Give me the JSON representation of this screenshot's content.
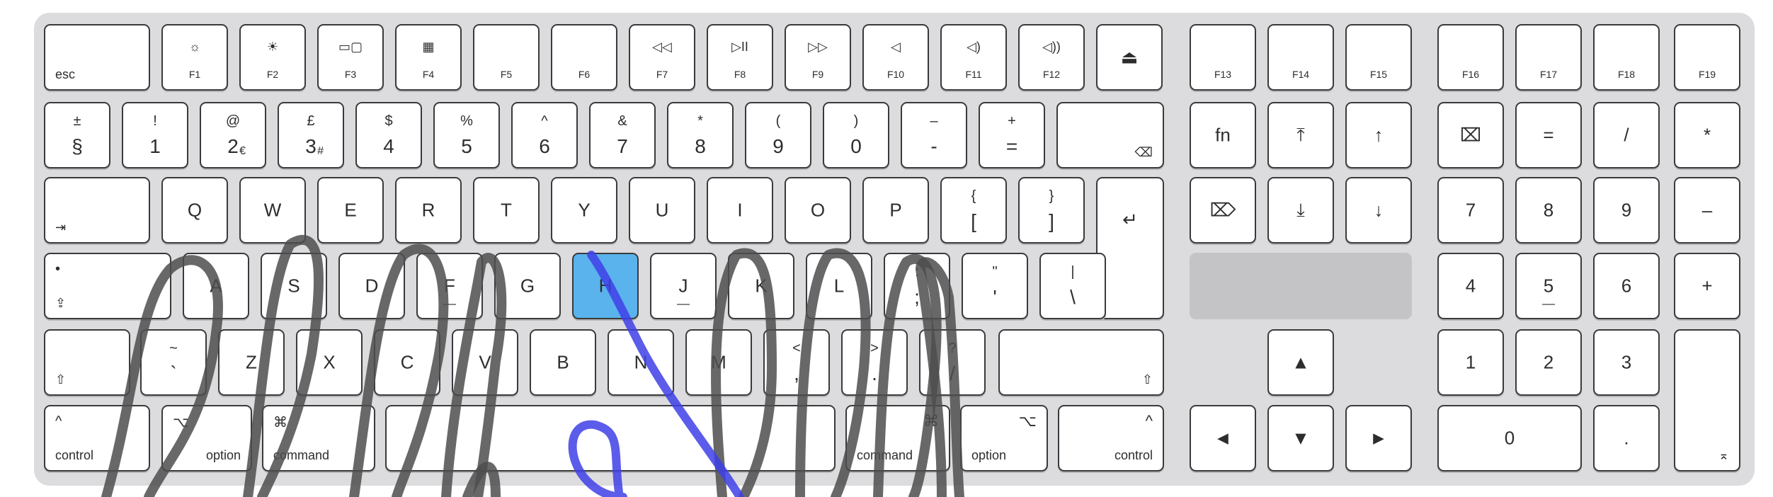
{
  "highlight_color": "#5ab3ec",
  "rows": {
    "function": [
      {
        "id": "esc",
        "label": "esc"
      },
      {
        "id": "f1",
        "icon": "brightness-down-icon",
        "label": "F1"
      },
      {
        "id": "f2",
        "icon": "brightness-up-icon",
        "label": "F2"
      },
      {
        "id": "f3",
        "icon": "mission-control-icon",
        "label": "F3"
      },
      {
        "id": "f4",
        "icon": "launchpad-icon",
        "label": "F4"
      },
      {
        "id": "f5",
        "icon": "",
        "label": "F5"
      },
      {
        "id": "f6",
        "icon": "",
        "label": "F6"
      },
      {
        "id": "f7",
        "icon": "rewind-icon",
        "label": "F7"
      },
      {
        "id": "f8",
        "icon": "play-pause-icon",
        "label": "F8"
      },
      {
        "id": "f9",
        "icon": "fast-forward-icon",
        "label": "F9"
      },
      {
        "id": "f10",
        "icon": "mute-icon",
        "label": "F10"
      },
      {
        "id": "f11",
        "icon": "volume-down-icon",
        "label": "F11"
      },
      {
        "id": "f12",
        "icon": "volume-up-icon",
        "label": "F12"
      },
      {
        "id": "eject",
        "icon": "eject-icon",
        "label": ""
      },
      {
        "id": "f13",
        "label": "F13"
      },
      {
        "id": "f14",
        "label": "F14"
      },
      {
        "id": "f15",
        "label": "F15"
      },
      {
        "id": "f16",
        "label": "F16"
      },
      {
        "id": "f17",
        "label": "F17"
      },
      {
        "id": "f18",
        "label": "F18"
      },
      {
        "id": "f19",
        "label": "F19"
      }
    ],
    "number": [
      {
        "id": "section",
        "upper": "±",
        "lower": "§"
      },
      {
        "id": "1",
        "upper": "!",
        "lower": "1"
      },
      {
        "id": "2",
        "upper": "@",
        "lower": "2",
        "extra": "€"
      },
      {
        "id": "3",
        "upper": "£",
        "lower": "3",
        "extra": "#"
      },
      {
        "id": "4",
        "upper": "$",
        "lower": "4"
      },
      {
        "id": "5",
        "upper": "%",
        "lower": "5"
      },
      {
        "id": "6",
        "upper": "^",
        "lower": "6"
      },
      {
        "id": "7",
        "upper": "&",
        "lower": "7"
      },
      {
        "id": "8",
        "upper": "*",
        "lower": "8"
      },
      {
        "id": "9",
        "upper": "(",
        "lower": "9"
      },
      {
        "id": "0",
        "upper": ")",
        "lower": "0"
      },
      {
        "id": "minus",
        "upper": "–",
        "lower": "-"
      },
      {
        "id": "equals",
        "upper": "+",
        "lower": "="
      },
      {
        "id": "delete",
        "icon": "delete-backward-icon",
        "label": "⌫"
      },
      {
        "id": "fn",
        "label": "fn"
      },
      {
        "id": "home",
        "icon": "home-icon",
        "label": "⤒"
      },
      {
        "id": "page-up",
        "icon": "page-up-icon",
        "label": "↑"
      },
      {
        "id": "clear",
        "icon": "clear-icon",
        "label": "⌧"
      },
      {
        "id": "np-equals",
        "label": "="
      },
      {
        "id": "np-divide",
        "label": "/"
      },
      {
        "id": "np-multiply",
        "label": "*"
      }
    ],
    "qwerty": [
      {
        "id": "tab",
        "icon": "tab-icon",
        "label": "⇥"
      },
      {
        "id": "q",
        "label": "Q"
      },
      {
        "id": "w",
        "label": "W"
      },
      {
        "id": "e",
        "label": "E"
      },
      {
        "id": "r",
        "label": "R"
      },
      {
        "id": "t",
        "label": "T"
      },
      {
        "id": "y",
        "label": "Y"
      },
      {
        "id": "u",
        "label": "U"
      },
      {
        "id": "i",
        "label": "I"
      },
      {
        "id": "o",
        "label": "O"
      },
      {
        "id": "p",
        "label": "P"
      },
      {
        "id": "bracket-left",
        "upper": "{",
        "lower": "["
      },
      {
        "id": "bracket-right",
        "upper": "}",
        "lower": "]"
      },
      {
        "id": "return",
        "icon": "return-icon",
        "label": "↵"
      },
      {
        "id": "forward-delete",
        "icon": "forward-delete-icon",
        "label": "⌦"
      },
      {
        "id": "end",
        "icon": "end-icon",
        "label": "⤓"
      },
      {
        "id": "page-down",
        "icon": "page-down-icon",
        "label": "↓"
      },
      {
        "id": "np-7",
        "label": "7"
      },
      {
        "id": "np-8",
        "label": "8"
      },
      {
        "id": "np-9",
        "label": "9"
      },
      {
        "id": "np-minus",
        "label": "–"
      }
    ],
    "home": [
      {
        "id": "caps-lock",
        "icon": "caps-lock-icon",
        "label": "⇪",
        "dot": "•"
      },
      {
        "id": "a",
        "label": "A"
      },
      {
        "id": "s",
        "label": "S"
      },
      {
        "id": "d",
        "label": "D"
      },
      {
        "id": "f",
        "label": "F",
        "bump": true
      },
      {
        "id": "g",
        "label": "G"
      },
      {
        "id": "h",
        "label": "H",
        "highlighted": true
      },
      {
        "id": "j",
        "label": "J",
        "bump": true
      },
      {
        "id": "k",
        "label": "K"
      },
      {
        "id": "l",
        "label": "L"
      },
      {
        "id": "semicolon",
        "upper": ":",
        "lower": ";"
      },
      {
        "id": "quote",
        "upper": "\"",
        "lower": "'"
      },
      {
        "id": "backslash",
        "upper": "|",
        "lower": "\\"
      },
      {
        "id": "np-4",
        "label": "4"
      },
      {
        "id": "np-5",
        "label": "5",
        "bump": true
      },
      {
        "id": "np-6",
        "label": "6"
      },
      {
        "id": "np-plus",
        "label": "+"
      }
    ],
    "bottom-letters": [
      {
        "id": "shift-left",
        "icon": "shift-icon",
        "label": "⇧"
      },
      {
        "id": "backtick",
        "upper": "~",
        "lower": "`"
      },
      {
        "id": "z",
        "label": "Z"
      },
      {
        "id": "x",
        "label": "X"
      },
      {
        "id": "c",
        "label": "C"
      },
      {
        "id": "v",
        "label": "V"
      },
      {
        "id": "b",
        "label": "B"
      },
      {
        "id": "n",
        "label": "N"
      },
      {
        "id": "m",
        "label": "M"
      },
      {
        "id": "comma",
        "upper": "<",
        "lower": ","
      },
      {
        "id": "period",
        "upper": ">",
        "lower": "."
      },
      {
        "id": "slash",
        "upper": "?",
        "lower": "/"
      },
      {
        "id": "shift-right",
        "icon": "shift-icon",
        "label": "⇧"
      },
      {
        "id": "arrow-up",
        "icon": "arrow-up-icon",
        "label": "▲"
      },
      {
        "id": "np-1",
        "label": "1"
      },
      {
        "id": "np-2",
        "label": "2"
      },
      {
        "id": "np-3",
        "label": "3"
      }
    ],
    "modifiers": [
      {
        "id": "control-left",
        "symbol": "^",
        "label": "control"
      },
      {
        "id": "option-left",
        "symbol": "⌥",
        "label": "option"
      },
      {
        "id": "command-left",
        "symbol": "⌘",
        "label": "command"
      },
      {
        "id": "space",
        "label": ""
      },
      {
        "id": "command-right",
        "symbol": "⌘",
        "label": "command"
      },
      {
        "id": "option-right",
        "symbol": "⌥",
        "label": "option"
      },
      {
        "id": "control-right",
        "symbol": "^",
        "label": "control"
      },
      {
        "id": "arrow-left",
        "icon": "arrow-left-icon",
        "label": "◄"
      },
      {
        "id": "arrow-down",
        "icon": "arrow-down-icon",
        "label": "▼"
      },
      {
        "id": "arrow-right",
        "icon": "arrow-right-icon",
        "label": "►"
      },
      {
        "id": "np-0",
        "label": "0"
      },
      {
        "id": "np-decimal",
        "label": "."
      },
      {
        "id": "np-enter",
        "icon": "enter-icon",
        "label": "⌅"
      }
    ]
  }
}
